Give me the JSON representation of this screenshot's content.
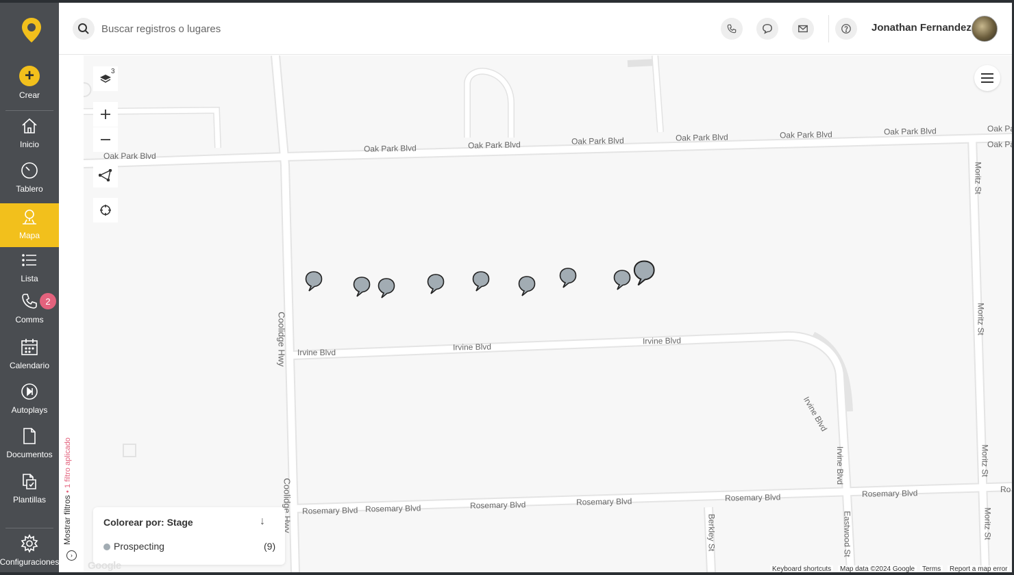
{
  "nav": {
    "crear": "Crear",
    "inicio": "Inicio",
    "tablero": "Tablero",
    "mapa": "Mapa",
    "lista": "Lista",
    "comms": "Comms",
    "comms_badge": "2",
    "calendario": "Calendario",
    "autoplays": "Autoplays",
    "documentos": "Documentos",
    "plantillas": "Plantillas",
    "configuraciones": "Configuraciones"
  },
  "topbar": {
    "search_placeholder": "Buscar registros o lugares",
    "user_name": "Jonathan Fernandez"
  },
  "map": {
    "layers_count": "3",
    "streets": {
      "oak1": "Oak Park Blvd",
      "oak2": "Oak Park Blvd",
      "oak3": "Oak Park Blvd",
      "oak4": "Oak Park Blvd",
      "oak5": "Oak Park Blvd",
      "oak6": "Oak Park Blvd",
      "oak7": "Oak Park Blvd",
      "oak8": "Oak Pa",
      "oak9": "Oak Pa",
      "coolidge1": "Coolidge Hwy",
      "coolidge2": "Coolidge Hwy",
      "irvine1": "Irvine Blvd",
      "irvine2": "Irvine Blvd",
      "irvine3": "Irvine Blvd",
      "irvine4": "Irvine Blvd",
      "irvine5": "Irvine Blvd",
      "moritz1": "Moritz St",
      "moritz2": "Moritz St",
      "moritz3": "Moritz St",
      "moritz4": "Moritz St",
      "rosemary1": "Rosemary Blvd",
      "rosemary2": "Rosemary Blvd",
      "rosemary3": "Rosemary Blvd",
      "rosemary4": "Rosemary Blvd",
      "rosemary5": "Rosemary Blvd",
      "rosemary6": "Rosemary Blvd",
      "rosemary7": "Ro",
      "berkley": "Berkley St",
      "eastwood": "Eastwood St"
    },
    "pin_color": "#a2acb3",
    "pin_count": 9
  },
  "filters": {
    "label": "Mostrar filtros",
    "applied": "• 1 filtro aplicado"
  },
  "legend": {
    "title": "Colorear por: Stage",
    "item_label": "Prospecting",
    "item_count": "(9)",
    "item_color": "#a2acb3"
  },
  "attribution": {
    "google": "Google",
    "keyboard": "Keyboard shortcuts",
    "map_data": "Map data ©2024 Google",
    "terms": "Terms",
    "report": "Report a map error"
  },
  "colors": {
    "sidebar_bg": "#4a4d51",
    "accent": "#f2c01c",
    "badge": "#e3627d"
  }
}
